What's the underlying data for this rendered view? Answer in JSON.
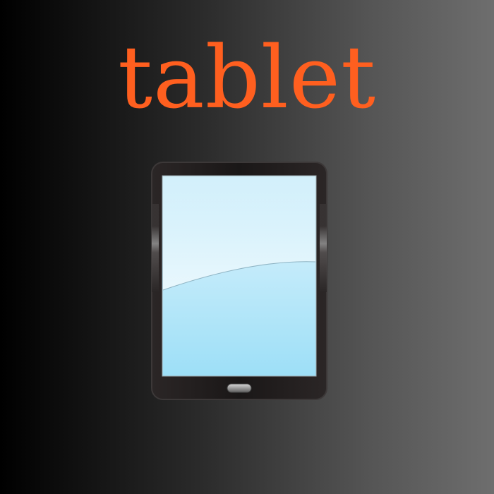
{
  "title": "tablet",
  "colors": {
    "title": "#ff5f1f",
    "background_start": "#000000",
    "background_end": "#6e6e6e",
    "tablet_body": "#1b1818",
    "screen_top": "#eaf7fd",
    "screen_bottom": "#9ddff7"
  },
  "icon": "tablet-icon"
}
